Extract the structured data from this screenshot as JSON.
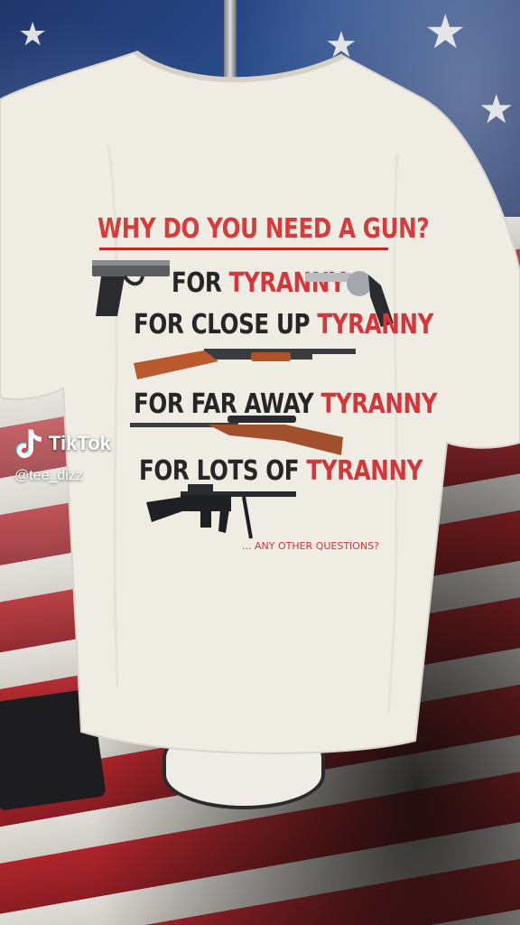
{
  "print": {
    "headline": "WHY DO YOU NEED A GUN?",
    "line1_prefix": "FOR ",
    "line1_red": "TYRANNY",
    "line2_prefix": "FOR CLOSE UP ",
    "line2_red": "TYRANNY",
    "line3_prefix": "FOR FAR AWAY ",
    "line3_red": "TYRANNY",
    "line4_prefix": "FOR LOTS OF ",
    "line4_red": "TYRANNY",
    "tagline": "... ANY OTHER QUESTIONS?"
  },
  "overlay": {
    "brand": "TikTok",
    "handle": "@tee_dizz"
  },
  "colors": {
    "shirt": "#efece4",
    "print_red": "#d6363a",
    "print_black": "#262626",
    "flag_blue": "#2a4c8c",
    "flag_red": "#b5252b"
  },
  "icons": [
    "tiktok-logo-icon",
    "pistol-icon",
    "revolver-icon",
    "shotgun-icon",
    "scoped-rifle-icon",
    "assault-rifle-icon"
  ]
}
